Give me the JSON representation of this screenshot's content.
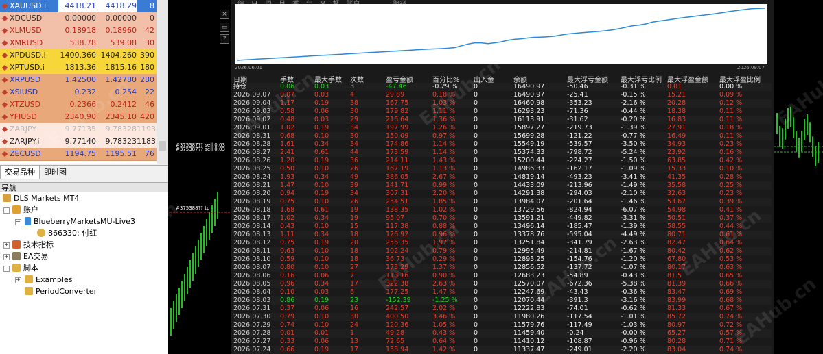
{
  "market_watch": {
    "rows": [
      {
        "symbol": "XAUUSD.i",
        "bid": "4418.21",
        "ask": "4418.29",
        "spread": "8",
        "bg": "#3a7bd5",
        "fg": "#ffffff",
        "name_bg": "#3a7bd5",
        "arrow": "dia"
      },
      {
        "symbol": "XDCUSD",
        "bid": "0.00000",
        "ask": "0.00000",
        "spread": "0",
        "bg": "#f2c0a8",
        "fg": "#333333",
        "arrow": "dia"
      },
      {
        "symbol": "XLMUSD",
        "bid": "0.18918",
        "ask": "0.18960",
        "spread": "42",
        "bg": "#f2c0a8",
        "fg": "#c02018",
        "arrow": "dia"
      },
      {
        "symbol": "XMRUSD",
        "bid": "538.78",
        "ask": "539.08",
        "spread": "30",
        "bg": "#f2c0a8",
        "fg": "#c02018",
        "arrow": "dia"
      },
      {
        "symbol": "XPDUSD.i",
        "bid": "1400.360",
        "ask": "1404.260",
        "spread": "390",
        "bg": "#f7d63a",
        "fg": "#222222",
        "arrow": "dia"
      },
      {
        "symbol": "XPTUSD.i",
        "bid": "1813.36",
        "ask": "1815.16",
        "spread": "180",
        "bg": "#f7d63a",
        "fg": "#222222",
        "arrow": "dia"
      },
      {
        "symbol": "XRPUSD",
        "bid": "1.42500",
        "ask": "1.42780",
        "spread": "280",
        "bg": "#e8a87a",
        "fg": "#1a3ad0",
        "arrow": "dia"
      },
      {
        "symbol": "XSIUSD",
        "bid": "0.232",
        "ask": "0.254",
        "spread": "22",
        "bg": "#e8a87a",
        "fg": "#1a3ad0",
        "arrow": "dia"
      },
      {
        "symbol": "XTZUSD",
        "bid": "0.2366",
        "ask": "0.2412",
        "spread": "46",
        "bg": "#e8a87a",
        "fg": "#c02018",
        "arrow": "dia"
      },
      {
        "symbol": "YFIUSD",
        "bid": "2340.90",
        "ask": "2345.10",
        "spread": "420",
        "bg": "#e8a87a",
        "fg": "#c02018",
        "arrow": "dia"
      },
      {
        "symbol": "ZARJPY",
        "bid": "9.77135",
        "ask": "9.78328",
        "spread": "1193",
        "bg": "#fde8e0",
        "fg": "#b8b8b8",
        "arrow": "dia"
      },
      {
        "symbol": "ZARJPY.i",
        "bid": "9.77140",
        "ask": "9.78323",
        "spread": "1183",
        "bg": "#fde8e0",
        "fg": "#222222",
        "arrow": "dia"
      },
      {
        "symbol": "ZECUSD",
        "bid": "1194.75",
        "ask": "1195.51",
        "spread": "76",
        "bg": "#e8a87a",
        "fg": "#1a3ad0",
        "arrow": "dia"
      }
    ]
  },
  "tabs": {
    "symbols": "交易品种",
    "tick_chart": "即时图"
  },
  "navigator": {
    "title": "导航",
    "root": "DLS Markets MT4",
    "accounts": "账户",
    "server": "BlueberryMarketsMU-Live3",
    "account": "866330: 付红",
    "indicators": "技术指标",
    "ea": "EA交易",
    "scripts": "脚本",
    "examples": "Examples",
    "period_converter": "PeriodConverter"
  },
  "chart_labels": {
    "l1": "#375387?? sell 0.03",
    "l2": "#375387?? sell 0.03",
    "l3": "#375388?? tp"
  },
  "report": {
    "periods": [
      "综",
      "日",
      "周",
      "月",
      "季",
      "年",
      "M",
      "督",
      "账户",
      "路径"
    ],
    "equity_start": "2026.06.01",
    "equity_end": "2026.09.07",
    "headers": [
      "日期",
      "手数",
      "最大手数",
      "次数",
      "盈亏金额",
      "百分比%",
      "出入金",
      "余额",
      "最大浮亏金额",
      "最大浮亏比例",
      "最大浮盈金额",
      "最大浮盈比例"
    ],
    "rows": [
      [
        "持仓",
        "0.06",
        "0.03",
        "3",
        "-47.46",
        "-0.29 %",
        "0",
        "16490.97",
        "-50.46",
        "-0.31 %",
        "0.01",
        "0.00 %"
      ],
      [
        "2026.09.07",
        "0.07",
        "0.03",
        "4",
        "29.89",
        "0.18 %",
        "0",
        "16490.97",
        "-25.41",
        "-0.15 %",
        "15.21",
        "0.09 %"
      ],
      [
        "2026.09.04",
        "1.17",
        "0.19",
        "38",
        "167.75",
        "1.03 %",
        "0",
        "16460.98",
        "-353.23",
        "-2.16 %",
        "20.28",
        "0.12 %"
      ],
      [
        "2026.09.03",
        "0.58",
        "0.06",
        "30",
        "179.82",
        "1.11 %",
        "0",
        "16293.23",
        "-71.36",
        "-0.44 %",
        "18.38",
        "0.11 %"
      ],
      [
        "2026.09.02",
        "0.48",
        "0.03",
        "29",
        "216.64",
        "1.36 %",
        "0",
        "16113.91",
        "-31.62",
        "-0.20 %",
        "16.83",
        "0.11 %"
      ],
      [
        "2026.09.01",
        "1.02",
        "0.19",
        "34",
        "197.99",
        "1.26 %",
        "0",
        "15897.27",
        "-219.73",
        "-1.39 %",
        "27.91",
        "0.18 %"
      ],
      [
        "2026.08.31",
        "0.68",
        "0.10",
        "30",
        "150.09",
        "0.97 %",
        "0",
        "15699.28",
        "-121.22",
        "-0.77 %",
        "16.49",
        "0.11 %"
      ],
      [
        "2026.08.28",
        "1.61",
        "0.34",
        "34",
        "174.86",
        "1.14 %",
        "0",
        "15549.19",
        "-539.57",
        "-3.50 %",
        "34.93",
        "0.23 %"
      ],
      [
        "2026.08.27",
        "2.41",
        "0.61",
        "44",
        "173.59",
        "1.14 %",
        "0",
        "15374.33",
        "-798.72",
        "-5.24 %",
        "23.92",
        "0.16 %"
      ],
      [
        "2026.08.26",
        "1.20",
        "0.19",
        "36",
        "214.11",
        "1.43 %",
        "0",
        "15200.44",
        "-224.27",
        "-1.50 %",
        "63.85",
        "0.42 %"
      ],
      [
        "2026.08.25",
        "0.50",
        "0.10",
        "26",
        "167.19",
        "1.13 %",
        "0",
        "14986.33",
        "-162.17",
        "-1.09 %",
        "15.33",
        "0.10 %"
      ],
      [
        "2026.08.24",
        "1.93",
        "0.34",
        "49",
        "386.05",
        "2.67 %",
        "0",
        "14819.14",
        "-493.23",
        "-3.41 %",
        "41.35",
        "0.28 %"
      ],
      [
        "2026.08.21",
        "1.47",
        "0.10",
        "39",
        "141.71",
        "0.99 %",
        "0",
        "14433.09",
        "-213.96",
        "-1.49 %",
        "35.58",
        "0.25 %"
      ],
      [
        "2026.08.20",
        "0.94",
        "0.19",
        "34",
        "307.31",
        "2.20 %",
        "0",
        "14291.38",
        "-294.03",
        "-2.10 %",
        "32.63",
        "0.23 %"
      ],
      [
        "2026.08.19",
        "0.75",
        "0.10",
        "26",
        "254.51",
        "1.85 %",
        "0",
        "13984.07",
        "-201.64",
        "-1.46 %",
        "53.67",
        "0.39 %"
      ],
      [
        "2026.08.18",
        "1.68",
        "0.61",
        "19",
        "138.35",
        "1.02 %",
        "0",
        "13729.56",
        "-824.94",
        "-6.07 %",
        "54.98",
        "0.41 %"
      ],
      [
        "2026.08.17",
        "1.02",
        "0.34",
        "19",
        "95.07",
        "0.70 %",
        "0",
        "13591.21",
        "-449.82",
        "-3.31 %",
        "50.51",
        "0.37 %"
      ],
      [
        "2026.08.14",
        "0.43",
        "0.10",
        "15",
        "117.38",
        "0.88 %",
        "0",
        "13496.14",
        "-185.47",
        "-1.39 %",
        "58.55",
        "0.44 %"
      ],
      [
        "2026.08.13",
        "1.11",
        "0.34",
        "18",
        "126.92",
        "0.96 %",
        "0",
        "13378.76",
        "-595.04",
        "-4.49 %",
        "80.71",
        "0.61 %"
      ],
      [
        "2026.08.12",
        "0.75",
        "0.19",
        "20",
        "256.35",
        "1.97 %",
        "0",
        "13251.84",
        "-341.79",
        "-2.63 %",
        "82.47",
        "0.64 %"
      ],
      [
        "2026.08.11",
        "0.63",
        "0.10",
        "18",
        "102.24",
        "0.79 %",
        "0",
        "12995.49",
        "-214.81",
        "-1.67 %",
        "80.42",
        "0.62 %"
      ],
      [
        "2026.08.10",
        "0.59",
        "0.10",
        "18",
        "36.73",
        "0.29 %",
        "0",
        "12893.25",
        "-154.76",
        "-1.20 %",
        "67.80",
        "0.53 %"
      ],
      [
        "2026.08.07",
        "0.80",
        "0.10",
        "27",
        "173.29",
        "1.37 %",
        "0",
        "12856.52",
        "-137.72",
        "-1.07 %",
        "80.17",
        "0.63 %"
      ],
      [
        "2026.08.06",
        "0.16",
        "0.06",
        "7",
        "113.16",
        "0.90 %",
        "0",
        "12683.23",
        "-54.89",
        "-0.43 %",
        "81.5",
        "0.65 %"
      ],
      [
        "2026.08.05",
        "0.96",
        "0.34",
        "17",
        "322.38",
        "2.63 %",
        "0",
        "12570.07",
        "-672.36",
        "-5.38 %",
        "81.39",
        "0.66 %"
      ],
      [
        "2026.08.04",
        "0.10",
        "0.03",
        "6",
        "177.25",
        "1.47 %",
        "0",
        "12247.69",
        "-43.43",
        "-0.36 %",
        "83.47",
        "0.69 %"
      ],
      [
        "2026.08.03",
        "0.86",
        "0.19",
        "23",
        "-152.39",
        "-1.25 %",
        "0",
        "12070.44",
        "-391.3",
        "-3.16 %",
        "83.99",
        "0.68 %"
      ],
      [
        "2026.07.31",
        "0.37",
        "0.06",
        "16",
        "242.57",
        "2.02 %",
        "0",
        "12222.83",
        "-74.01",
        "-0.62 %",
        "81.33",
        "0.67 %"
      ],
      [
        "2026.07.30",
        "0.79",
        "0.10",
        "30",
        "400.50",
        "3.46 %",
        "0",
        "11980.26",
        "-117.54",
        "-1.01 %",
        "85.72",
        "0.74 %"
      ],
      [
        "2026.07.29",
        "0.74",
        "0.10",
        "24",
        "120.36",
        "1.05 %",
        "0",
        "11579.76",
        "-117.49",
        "-1.03 %",
        "80.97",
        "0.72 %"
      ],
      [
        "2026.07.28",
        "0.01",
        "0.01",
        "1",
        "49.28",
        "0.43 %",
        "0",
        "11459.40",
        "-0.24",
        "-0.00 %",
        "65.27",
        "0.57 %"
      ],
      [
        "2026.07.27",
        "0.33",
        "0.06",
        "13",
        "72.65",
        "0.64 %",
        "0",
        "11410.12",
        "-108.87",
        "-0.96 %",
        "80.28",
        "0.71 %"
      ],
      [
        "2026.07.24",
        "0.66",
        "0.19",
        "17",
        "158.94",
        "1.42 %",
        "0",
        "11337.47",
        "-249.01",
        "-2.20 %",
        "83.04",
        "0.74 %"
      ]
    ]
  },
  "watermark": "EAHub.cn"
}
